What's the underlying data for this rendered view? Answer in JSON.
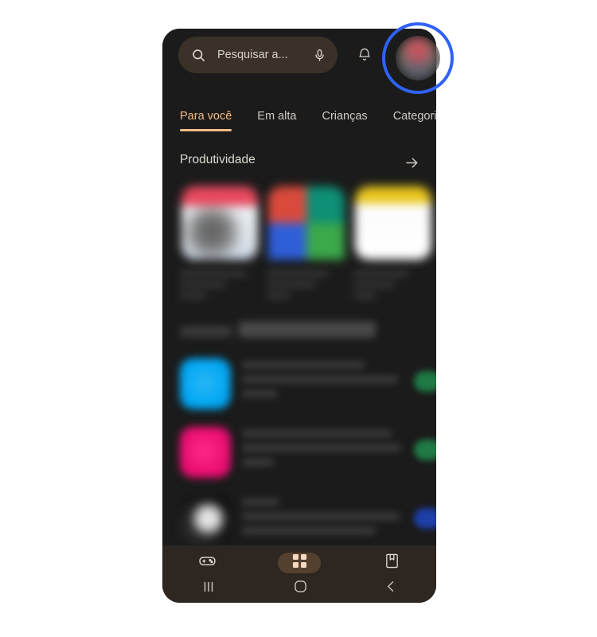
{
  "colors": {
    "page_background": "#ffffff",
    "phone_background": "#1b1b1b",
    "search_bar_fill": "#3a3128",
    "bottom_nav_fill": "#2e2620",
    "active_tab_accent": "#f4bb86",
    "selected_nav_pill": "#54402f",
    "annotation_circle": "#2f62f5",
    "install_button_green": "#1f7a45"
  },
  "header": {
    "search": {
      "placeholder": "Pesquisar a...",
      "search_icon": "search-icon",
      "mic_icon": "microphone-icon"
    },
    "notifications_icon": "bell-icon",
    "avatar_icon": "account-avatar"
  },
  "tabs": [
    {
      "label": "Para você",
      "active": true
    },
    {
      "label": "Em alta",
      "active": false
    },
    {
      "label": "Crianças",
      "active": false
    },
    {
      "label": "Categorias",
      "active": false
    }
  ],
  "section": {
    "title": "Produtividade",
    "more_arrow_icon": "arrow-right-icon"
  },
  "app_tiles": [
    {
      "name": "app-tile-1"
    },
    {
      "name": "app-tile-2"
    },
    {
      "name": "app-tile-3"
    }
  ],
  "list_items": [
    {
      "name": "list-item-1"
    },
    {
      "name": "list-item-2"
    },
    {
      "name": "list-item-3"
    }
  ],
  "bottom_nav": [
    {
      "label": "Jogos",
      "icon": "gamepad-icon",
      "selected": false
    },
    {
      "label": "Apps",
      "icon": "grid-apps-icon",
      "selected": true
    },
    {
      "label": "Livros",
      "icon": "bookmark-book-icon",
      "selected": false
    }
  ],
  "system_nav": [
    {
      "icon": "recents-icon"
    },
    {
      "icon": "home-icon"
    },
    {
      "icon": "back-icon"
    }
  ],
  "annotation": {
    "shape": "circle-highlight",
    "target": "account-avatar"
  }
}
